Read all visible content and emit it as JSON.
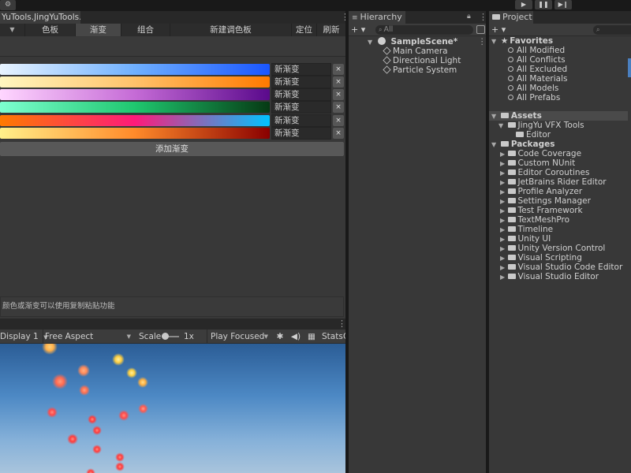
{
  "toolbar": {
    "tool_icon": "tools-icon",
    "play_icon": "▶",
    "pause_icon": "❚❚",
    "step_icon": "▶❙"
  },
  "gradient_window": {
    "title": "YuTools.JingYuTools...",
    "nav": {
      "dropdown_arrow": "▼",
      "palette": "色板",
      "gradient": "渐变",
      "combo": "组合",
      "new_palette": "新建调色板",
      "locate": "定位",
      "refresh": "刷新"
    },
    "gradients": [
      {
        "name": "新渐变",
        "colors": [
          "#e8f4ff",
          "#6fb0ff",
          "#1a56ff"
        ]
      },
      {
        "name": "新渐变",
        "colors": [
          "#fff7c0",
          "#ffc26a",
          "#ff7a00"
        ]
      },
      {
        "name": "新渐变",
        "colors": [
          "#ffd6ff",
          "#c56bd6",
          "#5a0a8c"
        ]
      },
      {
        "name": "新渐变",
        "colors": [
          "#7dffd0",
          "#1fc76f",
          "#063a14"
        ]
      },
      {
        "name": "新渐变",
        "colors": [
          "#ff7a00",
          "#ff1a7a",
          "#00c4ff"
        ]
      },
      {
        "name": "新渐变",
        "colors": [
          "#fff08a",
          "#ff8a2a",
          "#8a0000"
        ]
      }
    ],
    "delete_label": "×",
    "add_gradient": "添加渐变",
    "status_text": "颜色或渐变可以使用复制粘贴功能"
  },
  "game_view": {
    "display": "Display 1",
    "aspect": "Free Aspect",
    "scale_label": "Scale",
    "scale_value": "1x",
    "play_mode": "Play Focused",
    "stats": "Stats",
    "gizmos": "G"
  },
  "hierarchy": {
    "tab_label": "Hierarchy",
    "add_label": "+ ▾",
    "search_placeholder": "All",
    "scene": "SampleScene*",
    "objects": [
      "Main Camera",
      "Directional Light",
      "Particle System"
    ]
  },
  "project": {
    "tab_label": "Project",
    "add_label": "+ ▾",
    "favorites_label": "Favorites",
    "favorites": [
      "All Modified",
      "All Conflicts",
      "All Excluded",
      "All Materials",
      "All Models",
      "All Prefabs"
    ],
    "assets_label": "Assets",
    "assets": [
      {
        "name": "JingYu VFX Tools",
        "children": [
          "Editor"
        ]
      }
    ],
    "packages_label": "Packages",
    "packages": [
      "Code Coverage",
      "Custom NUnit",
      "Editor Coroutines",
      "JetBrains Rider Editor",
      "Profile Analyzer",
      "Settings Manager",
      "Test Framework",
      "TextMeshPro",
      "Timeline",
      "Unity UI",
      "Unity Version Control",
      "Visual Scripting",
      "Visual Studio Code Editor",
      "Visual Studio Editor"
    ]
  }
}
